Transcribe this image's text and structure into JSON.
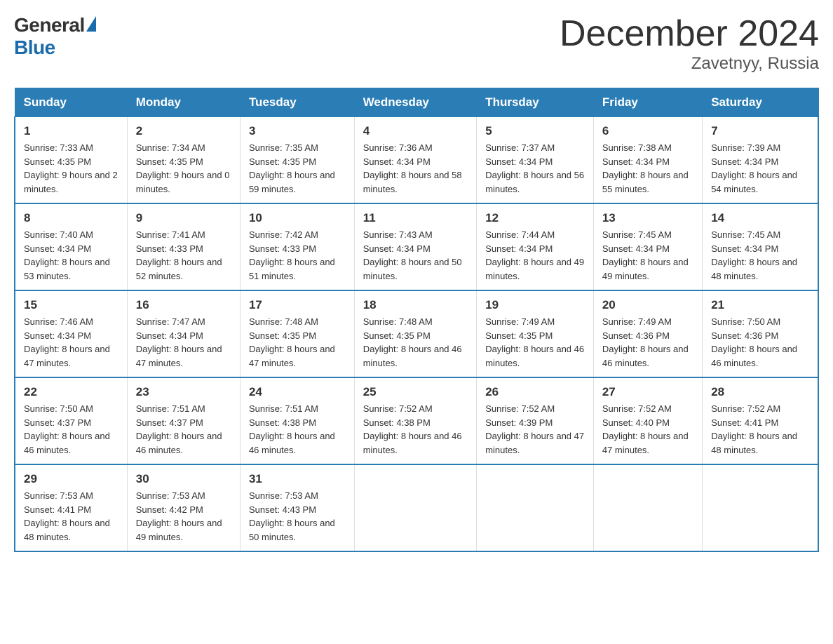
{
  "logo": {
    "general": "General",
    "blue": "Blue"
  },
  "title": "December 2024",
  "subtitle": "Zavetnyy, Russia",
  "days_of_week": [
    "Sunday",
    "Monday",
    "Tuesday",
    "Wednesday",
    "Thursday",
    "Friday",
    "Saturday"
  ],
  "weeks": [
    [
      {
        "num": "1",
        "sunrise": "7:33 AM",
        "sunset": "4:35 PM",
        "daylight": "9 hours and 2 minutes."
      },
      {
        "num": "2",
        "sunrise": "7:34 AM",
        "sunset": "4:35 PM",
        "daylight": "9 hours and 0 minutes."
      },
      {
        "num": "3",
        "sunrise": "7:35 AM",
        "sunset": "4:35 PM",
        "daylight": "8 hours and 59 minutes."
      },
      {
        "num": "4",
        "sunrise": "7:36 AM",
        "sunset": "4:34 PM",
        "daylight": "8 hours and 58 minutes."
      },
      {
        "num": "5",
        "sunrise": "7:37 AM",
        "sunset": "4:34 PM",
        "daylight": "8 hours and 56 minutes."
      },
      {
        "num": "6",
        "sunrise": "7:38 AM",
        "sunset": "4:34 PM",
        "daylight": "8 hours and 55 minutes."
      },
      {
        "num": "7",
        "sunrise": "7:39 AM",
        "sunset": "4:34 PM",
        "daylight": "8 hours and 54 minutes."
      }
    ],
    [
      {
        "num": "8",
        "sunrise": "7:40 AM",
        "sunset": "4:34 PM",
        "daylight": "8 hours and 53 minutes."
      },
      {
        "num": "9",
        "sunrise": "7:41 AM",
        "sunset": "4:33 PM",
        "daylight": "8 hours and 52 minutes."
      },
      {
        "num": "10",
        "sunrise": "7:42 AM",
        "sunset": "4:33 PM",
        "daylight": "8 hours and 51 minutes."
      },
      {
        "num": "11",
        "sunrise": "7:43 AM",
        "sunset": "4:34 PM",
        "daylight": "8 hours and 50 minutes."
      },
      {
        "num": "12",
        "sunrise": "7:44 AM",
        "sunset": "4:34 PM",
        "daylight": "8 hours and 49 minutes."
      },
      {
        "num": "13",
        "sunrise": "7:45 AM",
        "sunset": "4:34 PM",
        "daylight": "8 hours and 49 minutes."
      },
      {
        "num": "14",
        "sunrise": "7:45 AM",
        "sunset": "4:34 PM",
        "daylight": "8 hours and 48 minutes."
      }
    ],
    [
      {
        "num": "15",
        "sunrise": "7:46 AM",
        "sunset": "4:34 PM",
        "daylight": "8 hours and 47 minutes."
      },
      {
        "num": "16",
        "sunrise": "7:47 AM",
        "sunset": "4:34 PM",
        "daylight": "8 hours and 47 minutes."
      },
      {
        "num": "17",
        "sunrise": "7:48 AM",
        "sunset": "4:35 PM",
        "daylight": "8 hours and 47 minutes."
      },
      {
        "num": "18",
        "sunrise": "7:48 AM",
        "sunset": "4:35 PM",
        "daylight": "8 hours and 46 minutes."
      },
      {
        "num": "19",
        "sunrise": "7:49 AM",
        "sunset": "4:35 PM",
        "daylight": "8 hours and 46 minutes."
      },
      {
        "num": "20",
        "sunrise": "7:49 AM",
        "sunset": "4:36 PM",
        "daylight": "8 hours and 46 minutes."
      },
      {
        "num": "21",
        "sunrise": "7:50 AM",
        "sunset": "4:36 PM",
        "daylight": "8 hours and 46 minutes."
      }
    ],
    [
      {
        "num": "22",
        "sunrise": "7:50 AM",
        "sunset": "4:37 PM",
        "daylight": "8 hours and 46 minutes."
      },
      {
        "num": "23",
        "sunrise": "7:51 AM",
        "sunset": "4:37 PM",
        "daylight": "8 hours and 46 minutes."
      },
      {
        "num": "24",
        "sunrise": "7:51 AM",
        "sunset": "4:38 PM",
        "daylight": "8 hours and 46 minutes."
      },
      {
        "num": "25",
        "sunrise": "7:52 AM",
        "sunset": "4:38 PM",
        "daylight": "8 hours and 46 minutes."
      },
      {
        "num": "26",
        "sunrise": "7:52 AM",
        "sunset": "4:39 PM",
        "daylight": "8 hours and 47 minutes."
      },
      {
        "num": "27",
        "sunrise": "7:52 AM",
        "sunset": "4:40 PM",
        "daylight": "8 hours and 47 minutes."
      },
      {
        "num": "28",
        "sunrise": "7:52 AM",
        "sunset": "4:41 PM",
        "daylight": "8 hours and 48 minutes."
      }
    ],
    [
      {
        "num": "29",
        "sunrise": "7:53 AM",
        "sunset": "4:41 PM",
        "daylight": "8 hours and 48 minutes."
      },
      {
        "num": "30",
        "sunrise": "7:53 AM",
        "sunset": "4:42 PM",
        "daylight": "8 hours and 49 minutes."
      },
      {
        "num": "31",
        "sunrise": "7:53 AM",
        "sunset": "4:43 PM",
        "daylight": "8 hours and 50 minutes."
      },
      null,
      null,
      null,
      null
    ]
  ]
}
